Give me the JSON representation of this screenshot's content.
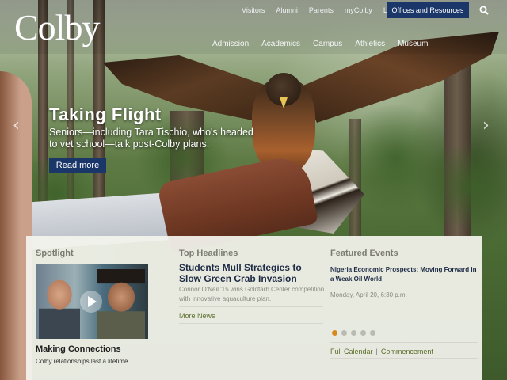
{
  "brand": {
    "logo": "Colby"
  },
  "utility_nav": [
    "Visitors",
    "Alumni",
    "Parents",
    "myColby",
    "Login"
  ],
  "offices_button": "Offices and Resources",
  "main_nav": [
    "Admission",
    "Academics",
    "Campus",
    "Athletics",
    "Museum"
  ],
  "slide": {
    "title": "Taking Flight",
    "description": "Seniors—including Tara Tischio, who's headed to vet school—talk post-Colby plans.",
    "cta": "Read more"
  },
  "spotlight": {
    "heading": "Spotlight",
    "title": "Making Connections",
    "subtitle": "Colby relationships last a lifetime."
  },
  "headlines": {
    "heading": "Top Headlines",
    "title": "Students Mull Strategies to Slow Green Crab Invasion",
    "subtitle": "Connor O'Neil '15 wins Goldfarb Center competition with innovative aquaculture plan.",
    "more": "More News"
  },
  "events": {
    "heading": "Featured Events",
    "title": "Nigeria Economic Prospects: Moving Forward in a Weak Oil World",
    "date": "Monday, April 20, 6:30 p.m.",
    "active_dot": 1,
    "dot_count": 5,
    "links": [
      "Full Calendar",
      "Commencement"
    ],
    "separator": "|"
  },
  "colors": {
    "navy": "#1b3769",
    "accent_orange": "#d98a1c",
    "link_green": "#5b6f2a"
  }
}
